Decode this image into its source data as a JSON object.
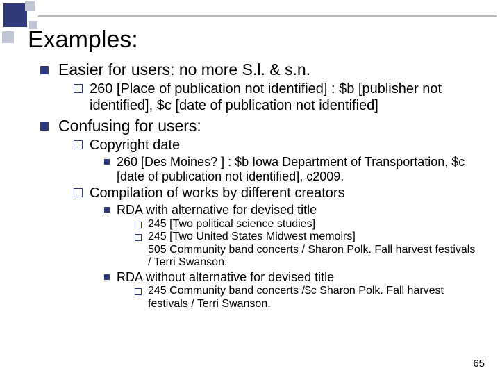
{
  "title": "Examples:",
  "pageNumber": "65",
  "items": [
    {
      "level": 1,
      "text": "Easier for users: no more S.l. & s.n."
    },
    {
      "level": 2,
      "text": "260  [Place of publication not identified] : $b [publisher not identified], $c [date of publication not identified]"
    },
    {
      "level": 1,
      "text": "Confusing for users:"
    },
    {
      "level": 2,
      "text": "Copyright date"
    },
    {
      "level": 3,
      "text": "260  [Des Moines? ] : $b Iowa Department of Transportation, $c [date of publication not identified], c2009."
    },
    {
      "level": 2,
      "text": "Compilation of works by different creators"
    },
    {
      "level": 3,
      "text": "RDA with alternative for devised title"
    },
    {
      "level": 4,
      "text": "245  [Two political science studies]"
    },
    {
      "level": 4,
      "text": "245  [Two United States Midwest memoirs]"
    },
    {
      "level": 4,
      "text": "    505 Community band concerts / Sharon Polk.  Fall harvest festivals / Terri Swanson.",
      "noBullet": true
    },
    {
      "level": 3,
      "text": "RDA without alternative for devised title"
    },
    {
      "level": 4,
      "text": "245  Community band concerts /$c Sharon Polk.  Fall harvest festivals / Terri Swanson."
    }
  ]
}
